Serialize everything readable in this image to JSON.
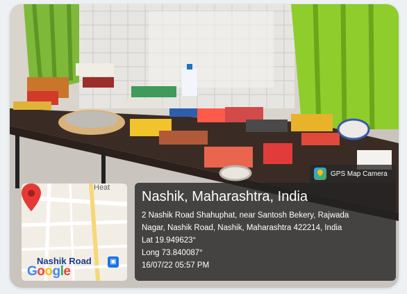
{
  "badge": {
    "app_name": "GPS Map Camera",
    "icon": "gps-map-camera-icon"
  },
  "info": {
    "location_title": "Nashik, Maharashtra, India",
    "address_line_1": "2 Nashik Road Shahuphat, near Santosh Bekery, Rajwada",
    "address_line_2": "Nagar, Nashik Road, Nashik, Maharashtra 422214, India",
    "latitude": "Lat 19.949623°",
    "longitude": "Long 73.840087°",
    "datetime": "16/07/22 05:57 PM"
  },
  "map": {
    "place_label": "Nashik Road",
    "partial_label": "Heat",
    "logo_letters": [
      "G",
      "o",
      "o",
      "g",
      "l",
      "e"
    ],
    "pin_color": "#e53935",
    "transit_icon": "transit-icon"
  }
}
